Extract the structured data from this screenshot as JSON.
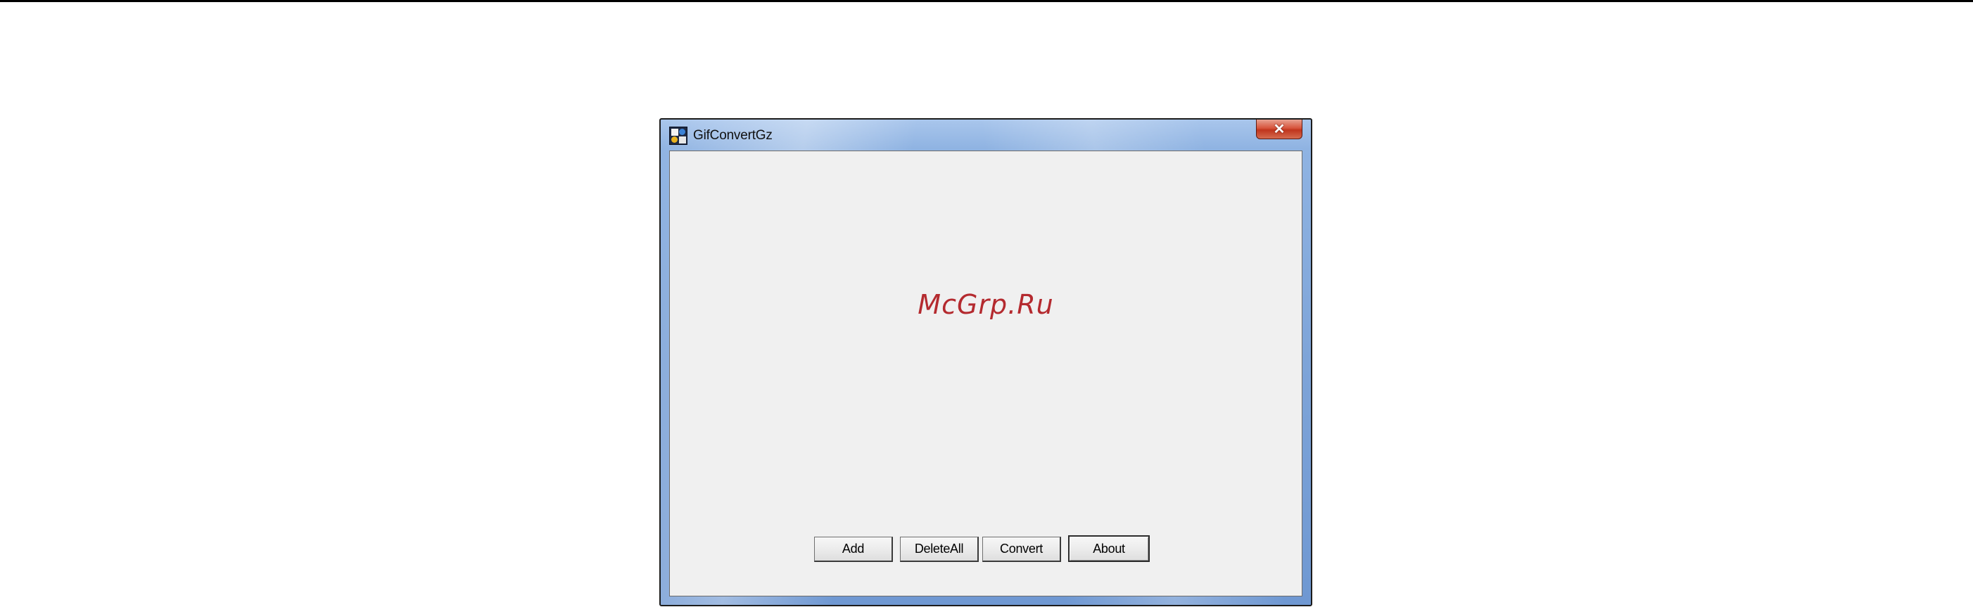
{
  "window": {
    "title": "GifConvertGz",
    "close_label": "✕",
    "icon": "app-icon"
  },
  "watermark": {
    "text": "McGrp.Ru"
  },
  "buttons": {
    "add": "Add",
    "delete_all": "DeleteAll",
    "convert": "Convert",
    "about": "About"
  },
  "colors": {
    "watermark": "#b42a2f",
    "client_bg": "#f0f0f0",
    "frame_glass": "#7ea4d8",
    "close_red": "#c0351d"
  }
}
